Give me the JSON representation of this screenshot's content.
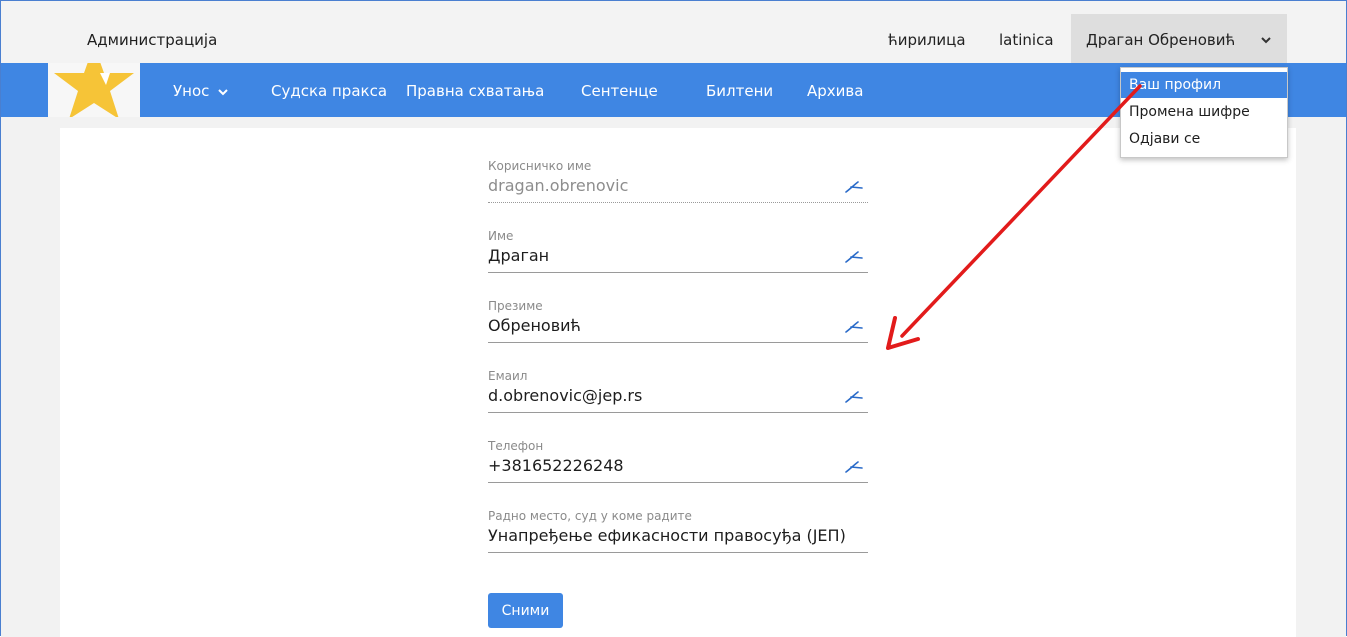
{
  "header": {
    "title": "Администрација",
    "lang_cyrillic": "ћирилица",
    "lang_latin": "latinica",
    "user_name": "Драган Обреновић"
  },
  "nav": {
    "items": [
      {
        "label": "Унос",
        "has_dropdown": true
      },
      {
        "label": "Судска пракса"
      },
      {
        "label": "Правна схватања"
      },
      {
        "label": "Сентенце"
      },
      {
        "label": "Билтени"
      },
      {
        "label": "Архива"
      }
    ]
  },
  "user_dropdown": {
    "items": [
      {
        "label": "Ваш профил",
        "active": true
      },
      {
        "label": "Промена шифре"
      },
      {
        "label": "Одјави се"
      }
    ]
  },
  "form": {
    "fields": [
      {
        "label": "Корисничко име",
        "value": "dragan.obrenovic",
        "readonly": true
      },
      {
        "label": "Име",
        "value": "Драган"
      },
      {
        "label": "Презиме",
        "value": "Обреновић"
      },
      {
        "label": "Емаил",
        "value": "d.obrenovic@jep.rs"
      },
      {
        "label": "Телефон",
        "value": "+381652226248"
      },
      {
        "label": "Радно место, суд у коме радите",
        "value": "Унапређење ефикасности правосуђа (ЈЕП)"
      }
    ],
    "save_label": "Сними"
  },
  "colors": {
    "primary": "#3f86e3",
    "annotation_arrow": "#e21b1b",
    "page_bg": "#f2f2f2",
    "topbar_bg": "#f3f3f3"
  }
}
